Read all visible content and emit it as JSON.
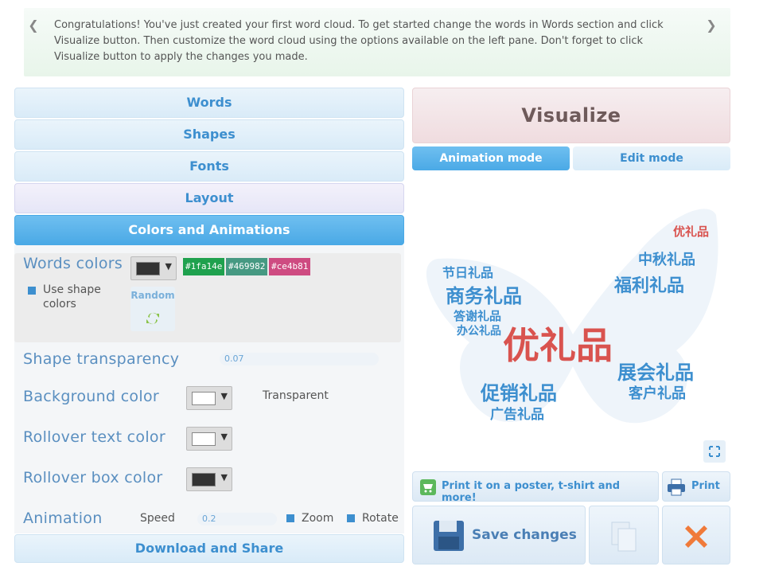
{
  "notice": {
    "message": "Congratulations! You've just created your first word cloud. To get started change the words in Words section and click Visualize button. Then customize the word cloud using the options available on the left pane. Don't forget to click Visualize button to apply the changes you made.",
    "prev_glyph": "❮",
    "next_glyph": "❯"
  },
  "accordion": {
    "words": "Words",
    "shapes": "Shapes",
    "fonts": "Fonts",
    "layout": "Layout",
    "colors": "Colors and Animations"
  },
  "colors_panel": {
    "words_colors_label": "Words colors",
    "use_shape_colors_line1": "Use shape",
    "use_shape_colors_line2": "colors",
    "color_chips": [
      "#1fa14e",
      "#469982",
      "#ce4b81"
    ],
    "random_label": "Random",
    "shape_transparency_label": "Shape transparency",
    "shape_transparency_value": "0.07",
    "background_color_label": "Background color",
    "transparent_label": "Transparent",
    "rollover_text_color_label": "Rollover text color",
    "rollover_box_color_label": "Rollover box color",
    "animation_label": "Animation",
    "speed_label": "Speed",
    "speed_value": "0.2",
    "zoom_label": "Zoom",
    "rotate_label": "Rotate",
    "words_color_swatch": "#333333",
    "background_swatch": "#ffffff",
    "rollover_text_swatch": "#ffffff",
    "rollover_box_swatch": "#333333"
  },
  "download_label": "Download and Share",
  "visualize_label": "Visualize",
  "modes": {
    "animation": "Animation mode",
    "edit": "Edit mode"
  },
  "cloud_words": [
    {
      "text": "优礼品",
      "color": "#d9534f"
    },
    {
      "text": "商务礼品",
      "color": "#3d8fcf"
    },
    {
      "text": "中秋礼品",
      "color": "#3d8fcf"
    },
    {
      "text": "福利礼品",
      "color": "#3d8fcf"
    },
    {
      "text": "展会礼品",
      "color": "#3d8fcf"
    },
    {
      "text": "促销礼品",
      "color": "#3d8fcf"
    },
    {
      "text": "客户礼品",
      "color": "#3d8fcf"
    },
    {
      "text": "节日礼品",
      "color": "#3d8fcf"
    },
    {
      "text": "答谢礼品",
      "color": "#3d8fcf"
    },
    {
      "text": "办公礼品",
      "color": "#3d8fcf"
    },
    {
      "text": "广告礼品",
      "color": "#3d8fcf"
    },
    {
      "text": "优礼品",
      "color": "#d9534f"
    }
  ],
  "actions": {
    "print_poster": "Print it on a poster, t-shirt and more!",
    "print": "Print",
    "save_changes": "Save changes"
  },
  "colors": {
    "accent": "#4aa9e6",
    "label_blue": "#5a8fc0",
    "red": "#d9534f"
  }
}
